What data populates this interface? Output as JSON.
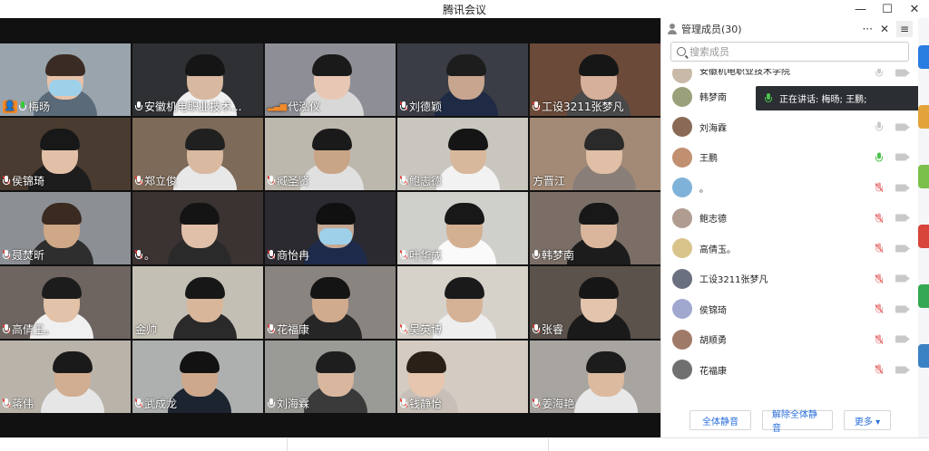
{
  "window": {
    "title": "腾讯会议",
    "minimize": "—",
    "maximize": "☐",
    "close": "✕"
  },
  "video_tiles": [
    {
      "name": "梅旸",
      "mic": "active",
      "host": true,
      "bg": "#9aa4ac",
      "skin": "#e6c2a8",
      "hair": "#3a2c24",
      "shirt": "#5a6a78",
      "fx": 52,
      "has_mask": true
    },
    {
      "name": "安徽机电职业技术...",
      "mic": "on",
      "bg": "#2e3034",
      "skin": "#d8b8a0",
      "hair": "#151515",
      "shirt": "#f0f0f0",
      "fx": 60
    },
    {
      "name": "代泓仪",
      "mic": "signal",
      "bg": "#8e8f96",
      "skin": "#e8c8b4",
      "hair": "#1a1a1a",
      "shirt": "#d8d8d8",
      "fx": 54
    },
    {
      "name": "刘德颖",
      "mic": "off",
      "bg": "#3a3d46",
      "skin": "#c7a58e",
      "hair": "#1d1d1d",
      "shirt": "#1f2a44",
      "fx": 56
    },
    {
      "name": "工设3211张梦凡",
      "mic": "off",
      "bg": "#6b4a3a",
      "skin": "#d6b09a",
      "hair": "#161616",
      "shirt": "#4a4a4a",
      "fx": 56
    },
    {
      "name": "侯锦琦",
      "mic": "off",
      "bg": "#4a3b30",
      "skin": "#e2c0a8",
      "hair": "#181818",
      "shirt": "#1d1d1d",
      "fx": 46
    },
    {
      "name": "郑立俊",
      "mic": "off",
      "bg": "#7d6a58",
      "skin": "#d9b9a0",
      "hair": "#202020",
      "shirt": "#e8e8e8",
      "fx": 60
    },
    {
      "name": "臧圣贤",
      "mic": "off",
      "bg": "#bdb8ae",
      "skin": "#c9a588",
      "hair": "#1a1a1a",
      "shirt": "#e0e0e0",
      "fx": 54
    },
    {
      "name": "鲍志德",
      "mic": "off",
      "bg": "#c9c6bf",
      "skin": "#d8b89c",
      "hair": "#151515",
      "shirt": "#f2f2f2",
      "fx": 58
    },
    {
      "name": "方晋江",
      "mic": "none",
      "bg": "#a28a76",
      "skin": "#e0bfa6",
      "hair": "#2a2a2a",
      "shirt": "#8a7f78",
      "fx": 62
    },
    {
      "name": "聂焚昕",
      "mic": "off",
      "bg": "#8c8f94",
      "skin": "#cfa888",
      "hair": "#3a2a20",
      "shirt": "#2e2e2e",
      "fx": 48
    },
    {
      "name": "。",
      "mic": "off",
      "bg": "#3b3232",
      "skin": "#e0c0a8",
      "hair": "#141414",
      "shirt": "#2a2a2a",
      "fx": 54
    },
    {
      "name": "商怡冉",
      "mic": "off",
      "bg": "#2a2a30",
      "skin": "#c4a894",
      "hair": "#101010",
      "shirt": "#1e2a4a",
      "fx": 58,
      "has_mask": true
    },
    {
      "name": "叶华成",
      "mic": "off",
      "bg": "#cfcfcc",
      "skin": "#d4b092",
      "hair": "#181818",
      "shirt": "#fafafa",
      "fx": 54
    },
    {
      "name": "韩梦南",
      "mic": "on",
      "bg": "#7a6e66",
      "skin": "#dab79c",
      "hair": "#181818",
      "shirt": "#1c1c1c",
      "fx": 56
    },
    {
      "name": "高倩玉。",
      "mic": "off",
      "bg": "#6e6560",
      "skin": "#e2c2a8",
      "hair": "#1c1c1c",
      "shirt": "#f0f0f0",
      "fx": 48
    },
    {
      "name": "金帅",
      "mic": "none",
      "bg": "#c4bfb4",
      "skin": "#d8b69a",
      "hair": "#171717",
      "shirt": "#2a2a2a",
      "fx": 60
    },
    {
      "name": "花福康",
      "mic": "off",
      "bg": "#8a8480",
      "skin": "#d0ab8e",
      "hair": "#141414",
      "shirt": "#262626",
      "fx": 52
    },
    {
      "name": "吴英博",
      "mic": "off",
      "bg": "#d6d2ca",
      "skin": "#d5b196",
      "hair": "#1a1a1a",
      "shirt": "#eeeeee",
      "fx": 54
    },
    {
      "name": "张睿",
      "mic": "off",
      "bg": "#5b524c",
      "skin": "#e3c4ad",
      "hair": "#161616",
      "shirt": "#1a1a1a",
      "fx": 56
    },
    {
      "name": "蒋伟",
      "mic": "off",
      "bg": "#b9b3aa",
      "skin": "#d1ae92",
      "hair": "#1a1a1a",
      "shirt": "#e6e6e6",
      "fx": 60
    },
    {
      "name": "武成龙",
      "mic": "off",
      "bg": "#aeb0b0",
      "skin": "#cda88c",
      "hair": "#121212",
      "shirt": "#1c2430",
      "fx": 54
    },
    {
      "name": "刘海霖",
      "mic": "on",
      "bg": "#9a9a96",
      "skin": "#d9b79e",
      "hair": "#1e1e1e",
      "shirt": "#3a3a3a",
      "fx": 58
    },
    {
      "name": "钱静怡",
      "mic": "off",
      "bg": "#d4ccc2",
      "skin": "#e6c6ae",
      "hair": "#2a2018",
      "shirt": "#c8c0b8",
      "fx": 12
    },
    {
      "name": "姜海艳",
      "mic": "off",
      "bg": "#a8a4a0",
      "skin": "#dcbaa0",
      "hair": "#1c1c1c",
      "shirt": "#e8e8e8",
      "fx": 64
    }
  ],
  "panel": {
    "title": "管理成员(30)",
    "more": "···",
    "close": "✕",
    "menu": "≡",
    "search_placeholder": "搜索成员",
    "members": [
      {
        "name": "安徽机电职业技术学院",
        "mic": "plain",
        "avatar": "#c9b9a8",
        "partial": true
      },
      {
        "name": "韩梦南",
        "mic": "none",
        "avatar": "#9aa07a"
      },
      {
        "name": "刘海霖",
        "mic": "plain",
        "avatar": "#8a6a56"
      },
      {
        "name": "王鹏",
        "mic": "on",
        "avatar": "#c09070"
      },
      {
        "name": "。",
        "mic": "muted",
        "avatar": "#7fb2d8"
      },
      {
        "name": "鲍志德",
        "mic": "muted",
        "avatar": "#b09c90"
      },
      {
        "name": "高倩玉。",
        "mic": "muted",
        "avatar": "#d8c48a"
      },
      {
        "name": "工设3211张梦凡",
        "mic": "muted",
        "avatar": "#6a7080"
      },
      {
        "name": "侯锦琦",
        "mic": "muted",
        "avatar": "#a0a8d0"
      },
      {
        "name": "胡顺勇",
        "mic": "muted",
        "avatar": "#a07a68"
      },
      {
        "name": "花福康",
        "mic": "muted",
        "avatar": "#707070"
      }
    ],
    "speaking_label": "正在讲话: 梅旸; 王鹏;",
    "buttons": {
      "mute_all": "全体静音",
      "unmute_all": "解除全体静音",
      "more": "更多 ▾"
    }
  },
  "desktop_icon_colors": [
    "#2a7de1",
    "#e4a33a",
    "#7ac04a",
    "#d8453a",
    "#34a853",
    "#3b82c4"
  ]
}
